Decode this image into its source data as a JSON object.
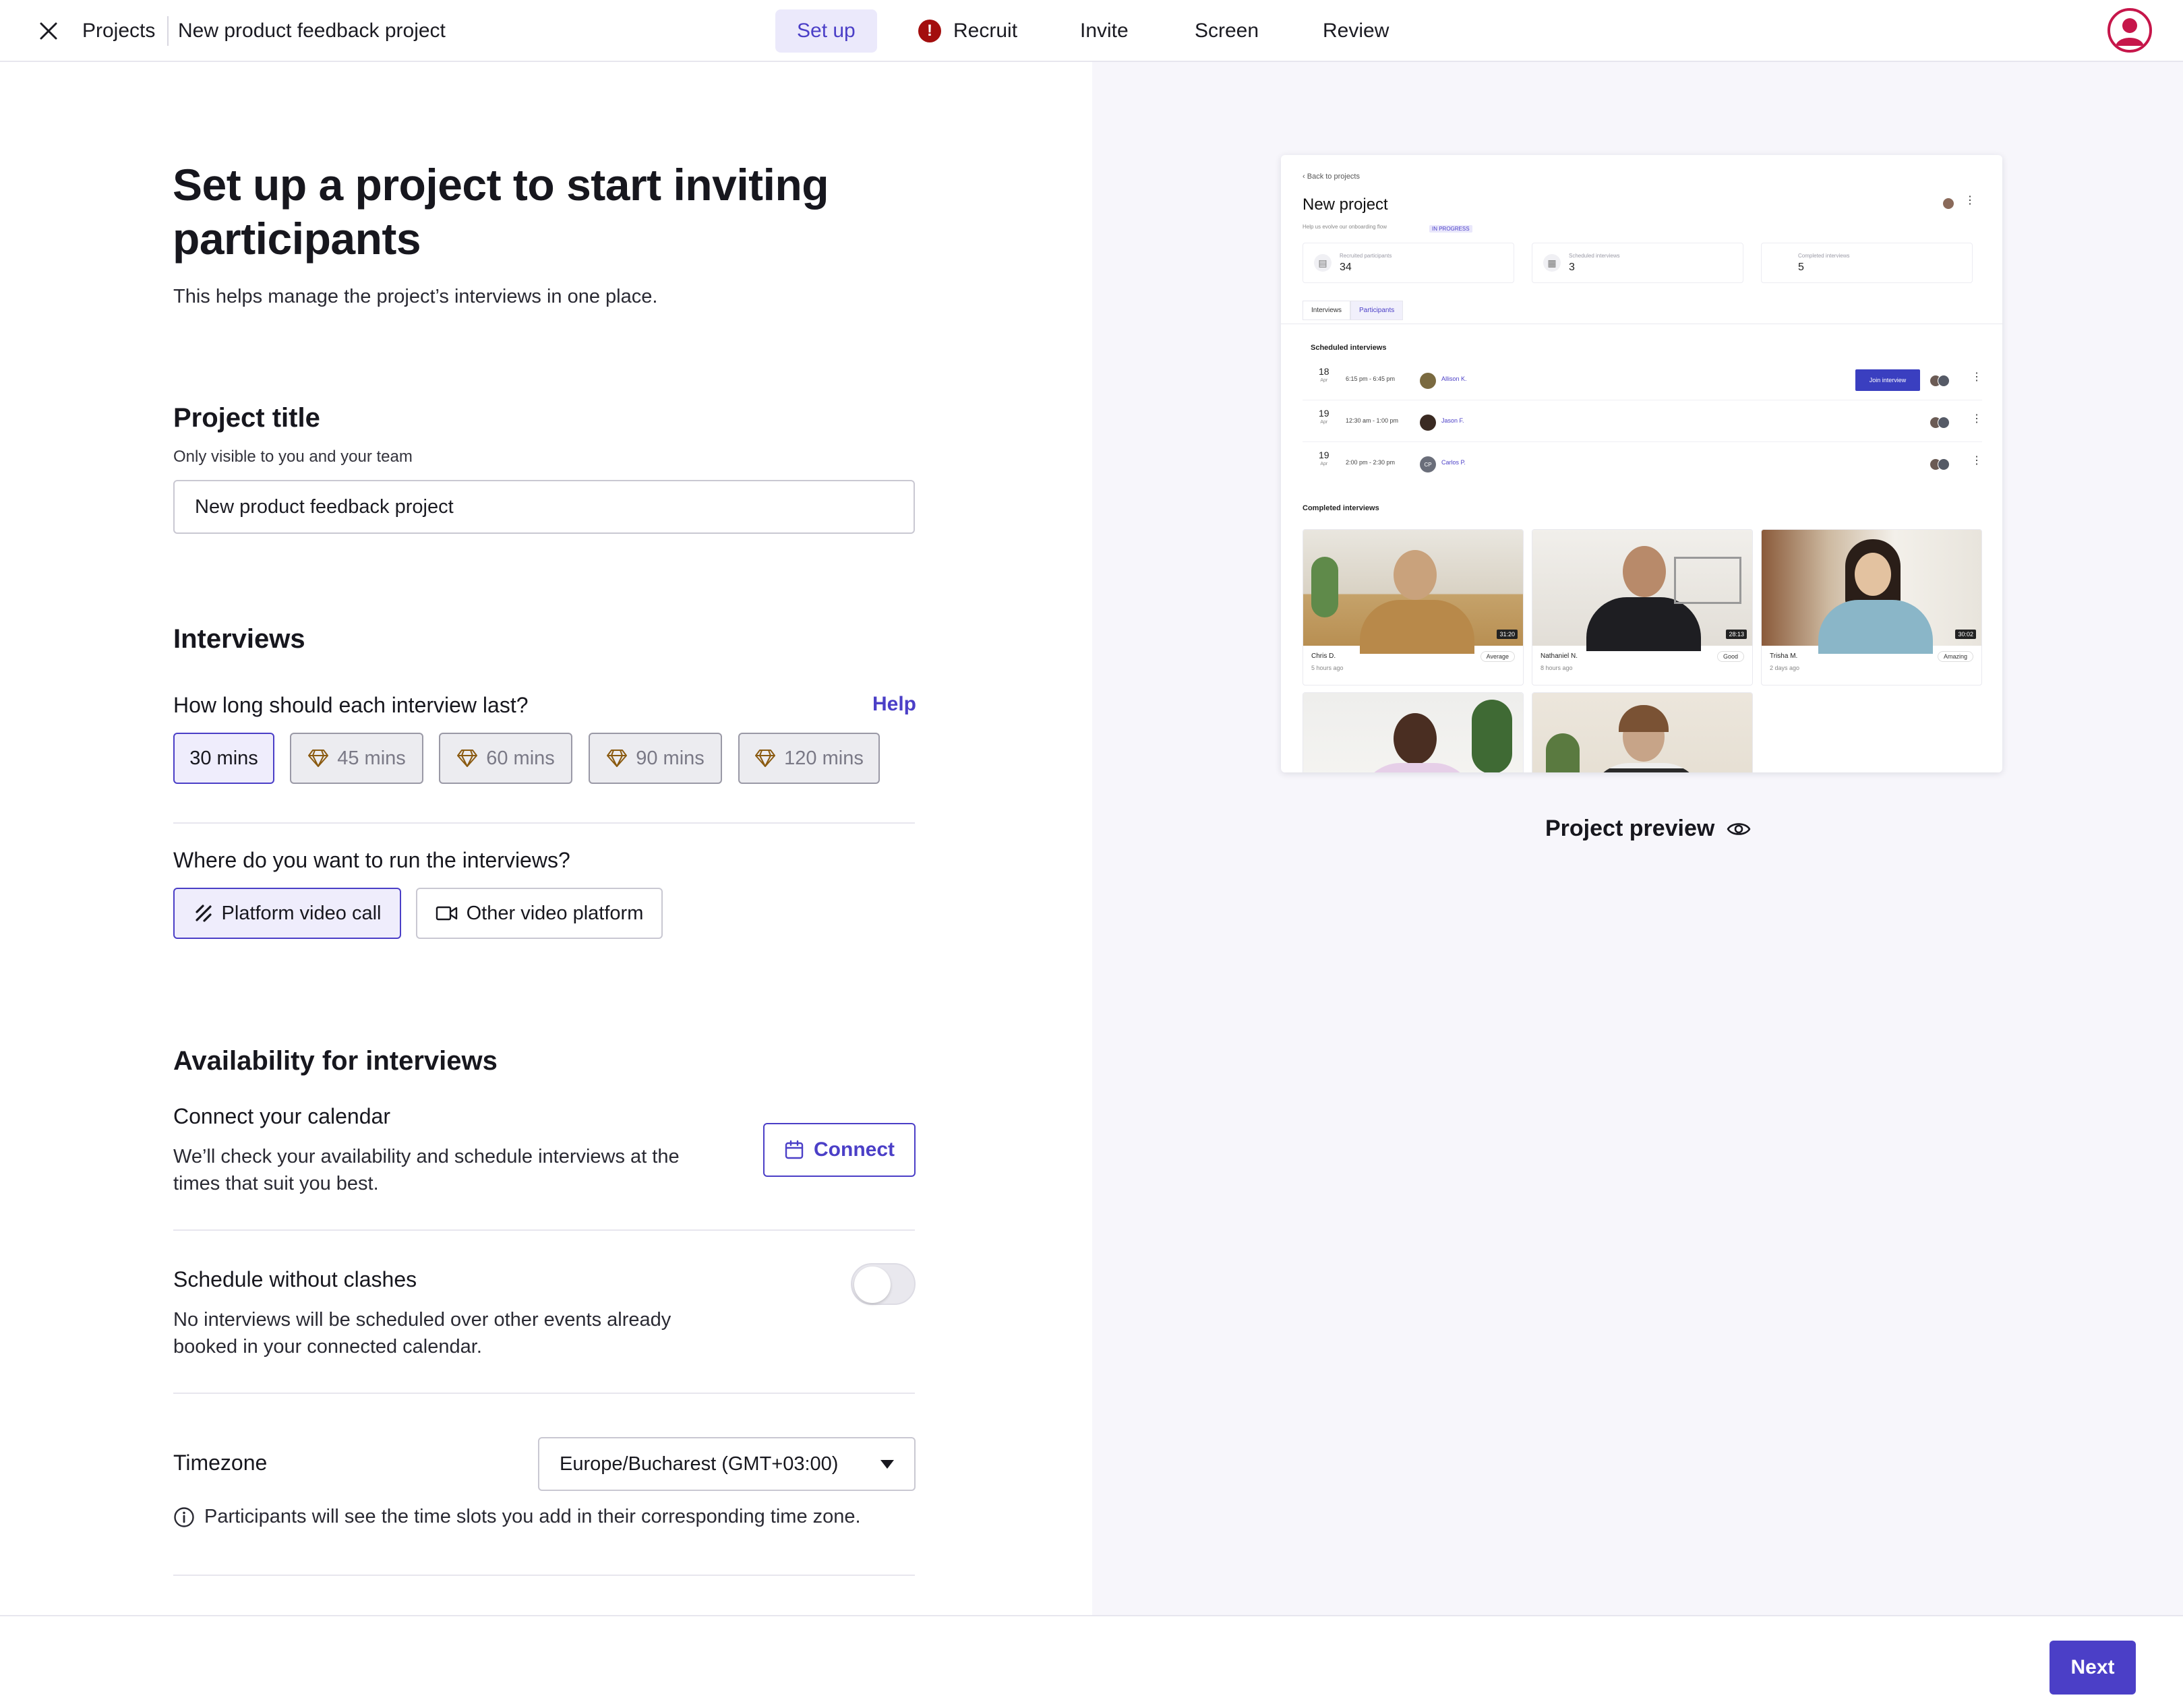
{
  "topbar": {
    "breadcrumb_root": "Projects",
    "breadcrumb_current": "New product feedback project",
    "tabs": [
      {
        "label": "Set up"
      },
      {
        "label": "Recruit",
        "alert": "!"
      },
      {
        "label": "Invite"
      },
      {
        "label": "Screen"
      },
      {
        "label": "Review"
      }
    ]
  },
  "form": {
    "title": "Set up a project to start inviting participants",
    "lead": "This helps manage the project’s interviews in one place.",
    "project_title": {
      "heading": "Project title",
      "hint": "Only visible to you and your team",
      "value": "New product feedback project"
    },
    "interviews": {
      "heading": "Interviews",
      "duration_question": "How long should each interview last?",
      "help_label": "Help",
      "durations": [
        {
          "label": "30 mins"
        },
        {
          "label": "45 mins"
        },
        {
          "label": "60 mins"
        },
        {
          "label": "90 mins"
        },
        {
          "label": "120 mins"
        }
      ],
      "location_question": "Where do you want to run the interviews?",
      "locations": [
        {
          "label": "Platform video call"
        },
        {
          "label": "Other video platform"
        }
      ]
    },
    "availability": {
      "heading": "Availability for interviews",
      "connect_heading": "Connect your calendar",
      "connect_desc": "We’ll check your availability and schedule interviews at the times that suit you best.",
      "connect_button": "Connect",
      "clash_heading": "Schedule without clashes",
      "clash_desc": "No interviews will be scheduled over other events already booked in your connected calendar.",
      "timezone_label": "Timezone",
      "timezone_value": "Europe/Bucharest (GMT+03:00)",
      "timezone_info": "Participants will see the time slots you add in their corresponding time zone."
    }
  },
  "preview": {
    "label": "Project preview",
    "back": "Back to projects",
    "project_name": "New project",
    "subtitle": "Help us evolve our onboarding flow",
    "status": "IN PROGRESS",
    "stats": [
      {
        "label": "Recruited participants",
        "value": "34"
      },
      {
        "label": "Scheduled interviews",
        "value": "3"
      },
      {
        "label": "Completed interviews",
        "value": "5"
      }
    ],
    "tabs": [
      "Interviews",
      "Participants"
    ],
    "scheduled_heading": "Scheduled interviews",
    "scheduled": [
      {
        "day": "18",
        "month": "Apr",
        "time": "6:15 pm - 6:45 pm",
        "name": "Allison K."
      },
      {
        "day": "19",
        "month": "Apr",
        "time": "12:30 am - 1:00 pm",
        "name": "Jason F."
      },
      {
        "day": "19",
        "month": "Apr",
        "time": "2:00 pm - 2:30 pm",
        "name": "Carlos P.",
        "initials": "CP"
      }
    ],
    "join_label": "Join interview",
    "completed_heading": "Completed interviews",
    "completed": [
      {
        "name": "Chris D.",
        "ago": "5 hours ago",
        "rating": "Average",
        "duration": "31:20"
      },
      {
        "name": "Nathaniel N.",
        "ago": "8 hours ago",
        "rating": "Good",
        "duration": "28:13"
      },
      {
        "name": "Trisha M.",
        "ago": "2 days ago",
        "rating": "Amazing",
        "duration": "30:02"
      }
    ]
  },
  "footer": {
    "next_label": "Next"
  },
  "colors": {
    "accent": "#4b3fc7",
    "accent_soft": "#ebe9fb",
    "alert": "#a30e0e",
    "avatar_ring": "#c6164a",
    "preview_bg": "#f7f6fb"
  }
}
